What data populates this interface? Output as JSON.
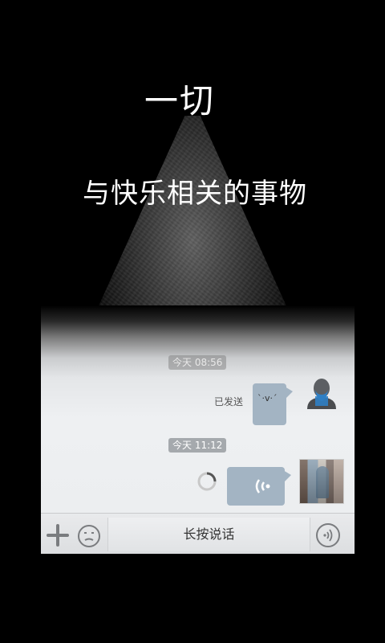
{
  "overlay": {
    "title": "一切",
    "subtitle": "与快乐相关的事物"
  },
  "chat": {
    "timestamps": [
      "今天 08:56",
      "今天 11:12"
    ],
    "messages": [
      {
        "status": "已发送",
        "content": "`·v·´",
        "type": "text"
      },
      {
        "type": "voice",
        "status": "sending"
      }
    ],
    "input_bar": {
      "hold_to_talk_label": "长按说话"
    }
  },
  "colors": {
    "bubble": "#a3b4c3",
    "background": "#000000",
    "chat_bg": "#eceef0"
  },
  "icons": [
    "plus-icon",
    "emoji-icon",
    "voice-wave-icon",
    "loading-spinner-icon",
    "avatar-icon"
  ]
}
